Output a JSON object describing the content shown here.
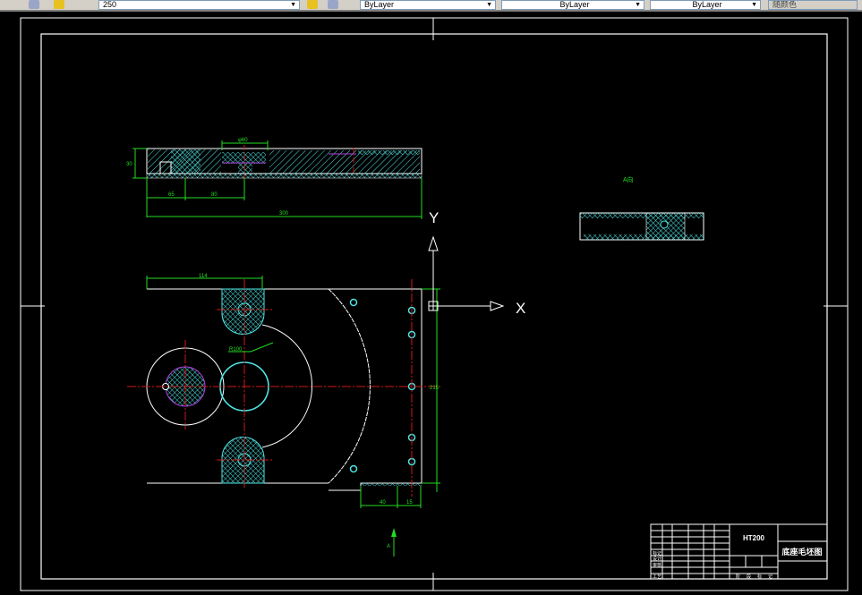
{
  "toolbar": {
    "layer_combo": "250",
    "color_combo": "ByLayer",
    "linetype_combo": "ByLayer",
    "lineweight_combo": "ByLayer",
    "plotstyle_combo": "随颜色"
  },
  "drawing": {
    "dims": {
      "top_height": "30",
      "top_width_small": "65",
      "top_width_mid": "80",
      "top_slot": "φ60",
      "top_total": "300",
      "plan_width": "114",
      "plan_radius": "R100",
      "plan_height": "215",
      "plan_bottom_a": "40",
      "plan_bottom_b": "15"
    },
    "view_label": "A向",
    "ucs_x": "X",
    "ucs_y": "Y",
    "arrow_label": "A"
  },
  "title_block": {
    "material": "HT200",
    "drawing_name": "底座毛坯图",
    "row_labels": [
      "标记",
      "设计",
      "审核",
      "工艺"
    ],
    "scale_labels": [
      "阶",
      "段",
      "标",
      "记"
    ]
  },
  "colors": {
    "background": "#000000",
    "frame": "#ffffff",
    "hatch": "#4fe3e3",
    "center": "#d01818",
    "dim": "#22dd22",
    "hidden": "#b040e0"
  }
}
